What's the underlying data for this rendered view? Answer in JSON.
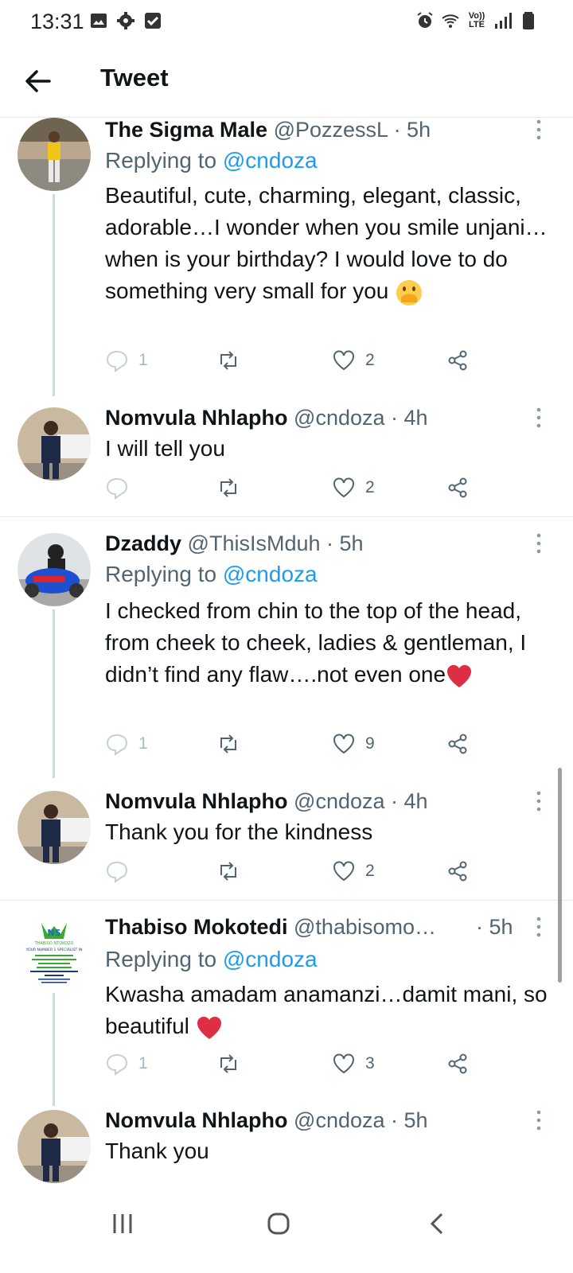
{
  "status_bar": {
    "time": "13:31",
    "network_label": "Vo)) LTE"
  },
  "header": {
    "title": "Tweet"
  },
  "tweets": [
    {
      "name": "The Sigma Male",
      "handle": "@PozzessL",
      "time": "· 5h",
      "replying_prefix": "Replying to",
      "replying_handle": "@cndoza",
      "text": "Beautiful, cute, charming, elegant, classic, adorable…I wonder when you smile unjani… when is your birthday? I would love to do something very small for you",
      "emoji": "hand-over-mouth-emoji",
      "reply_count": "1",
      "like_count": "2"
    },
    {
      "name": "Nomvula Nhlapho",
      "handle": "@cndoza",
      "time": "· 4h",
      "text": "I will tell you",
      "reply_count": "",
      "like_count": "2"
    },
    {
      "name": "Dzaddy",
      "handle": "@ThisIsMduh",
      "time": "· 5h",
      "replying_prefix": "Replying to",
      "replying_handle": "@cndoza",
      "text": "I checked from chin to the top of the head, from cheek to cheek, ladies & gentleman, I didn’t find any flaw….not even one",
      "emoji": "red-heart-emoji",
      "reply_count": "1",
      "like_count": "9"
    },
    {
      "name": "Nomvula Nhlapho",
      "handle": "@cndoza",
      "time": "· 4h",
      "text": "Thank you for the kindness",
      "reply_count": "",
      "like_count": "2"
    },
    {
      "name": "Thabiso Mokotedi",
      "handle": "@thabisomo…",
      "time": "· 5h",
      "replying_prefix": "Replying to",
      "replying_handle": "@cndoza",
      "text": "Kwasha amadam anamanzi…damit mani, so beautiful",
      "emoji": "red-heart-emoji",
      "reply_count": "1",
      "like_count": "3",
      "avatar_logo": {
        "initials": "NS",
        "brand": "THABISO NTOKOZO",
        "tagline": "YOUR NUMBER 1 SPECIALIST IN"
      }
    },
    {
      "name": "Nomvula Nhlapho",
      "handle": "@cndoza",
      "time": "· 5h",
      "text": "Thank you"
    }
  ],
  "colors": {
    "link": "#1d9bf0",
    "muted": "#536471",
    "heart": "#e0245e"
  }
}
